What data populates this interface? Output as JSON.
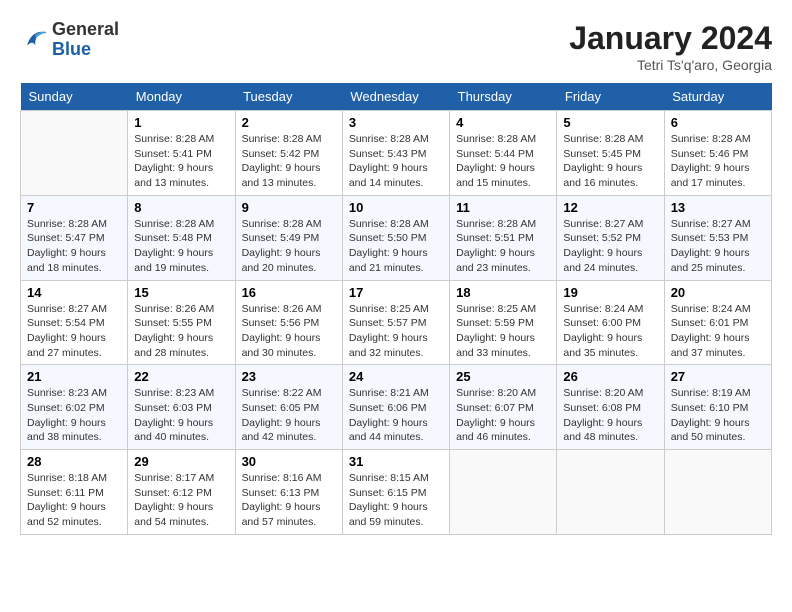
{
  "header": {
    "logo_general": "General",
    "logo_blue": "Blue",
    "month_title": "January 2024",
    "location": "Tetri Ts'q'aro, Georgia"
  },
  "weekdays": [
    "Sunday",
    "Monday",
    "Tuesday",
    "Wednesday",
    "Thursday",
    "Friday",
    "Saturday"
  ],
  "weeks": [
    [
      {
        "day": "",
        "info": ""
      },
      {
        "day": "1",
        "info": "Sunrise: 8:28 AM\nSunset: 5:41 PM\nDaylight: 9 hours\nand 13 minutes."
      },
      {
        "day": "2",
        "info": "Sunrise: 8:28 AM\nSunset: 5:42 PM\nDaylight: 9 hours\nand 13 minutes."
      },
      {
        "day": "3",
        "info": "Sunrise: 8:28 AM\nSunset: 5:43 PM\nDaylight: 9 hours\nand 14 minutes."
      },
      {
        "day": "4",
        "info": "Sunrise: 8:28 AM\nSunset: 5:44 PM\nDaylight: 9 hours\nand 15 minutes."
      },
      {
        "day": "5",
        "info": "Sunrise: 8:28 AM\nSunset: 5:45 PM\nDaylight: 9 hours\nand 16 minutes."
      },
      {
        "day": "6",
        "info": "Sunrise: 8:28 AM\nSunset: 5:46 PM\nDaylight: 9 hours\nand 17 minutes."
      }
    ],
    [
      {
        "day": "7",
        "info": "Sunrise: 8:28 AM\nSunset: 5:47 PM\nDaylight: 9 hours\nand 18 minutes."
      },
      {
        "day": "8",
        "info": "Sunrise: 8:28 AM\nSunset: 5:48 PM\nDaylight: 9 hours\nand 19 minutes."
      },
      {
        "day": "9",
        "info": "Sunrise: 8:28 AM\nSunset: 5:49 PM\nDaylight: 9 hours\nand 20 minutes."
      },
      {
        "day": "10",
        "info": "Sunrise: 8:28 AM\nSunset: 5:50 PM\nDaylight: 9 hours\nand 21 minutes."
      },
      {
        "day": "11",
        "info": "Sunrise: 8:28 AM\nSunset: 5:51 PM\nDaylight: 9 hours\nand 23 minutes."
      },
      {
        "day": "12",
        "info": "Sunrise: 8:27 AM\nSunset: 5:52 PM\nDaylight: 9 hours\nand 24 minutes."
      },
      {
        "day": "13",
        "info": "Sunrise: 8:27 AM\nSunset: 5:53 PM\nDaylight: 9 hours\nand 25 minutes."
      }
    ],
    [
      {
        "day": "14",
        "info": "Sunrise: 8:27 AM\nSunset: 5:54 PM\nDaylight: 9 hours\nand 27 minutes."
      },
      {
        "day": "15",
        "info": "Sunrise: 8:26 AM\nSunset: 5:55 PM\nDaylight: 9 hours\nand 28 minutes."
      },
      {
        "day": "16",
        "info": "Sunrise: 8:26 AM\nSunset: 5:56 PM\nDaylight: 9 hours\nand 30 minutes."
      },
      {
        "day": "17",
        "info": "Sunrise: 8:25 AM\nSunset: 5:57 PM\nDaylight: 9 hours\nand 32 minutes."
      },
      {
        "day": "18",
        "info": "Sunrise: 8:25 AM\nSunset: 5:59 PM\nDaylight: 9 hours\nand 33 minutes."
      },
      {
        "day": "19",
        "info": "Sunrise: 8:24 AM\nSunset: 6:00 PM\nDaylight: 9 hours\nand 35 minutes."
      },
      {
        "day": "20",
        "info": "Sunrise: 8:24 AM\nSunset: 6:01 PM\nDaylight: 9 hours\nand 37 minutes."
      }
    ],
    [
      {
        "day": "21",
        "info": "Sunrise: 8:23 AM\nSunset: 6:02 PM\nDaylight: 9 hours\nand 38 minutes."
      },
      {
        "day": "22",
        "info": "Sunrise: 8:23 AM\nSunset: 6:03 PM\nDaylight: 9 hours\nand 40 minutes."
      },
      {
        "day": "23",
        "info": "Sunrise: 8:22 AM\nSunset: 6:05 PM\nDaylight: 9 hours\nand 42 minutes."
      },
      {
        "day": "24",
        "info": "Sunrise: 8:21 AM\nSunset: 6:06 PM\nDaylight: 9 hours\nand 44 minutes."
      },
      {
        "day": "25",
        "info": "Sunrise: 8:20 AM\nSunset: 6:07 PM\nDaylight: 9 hours\nand 46 minutes."
      },
      {
        "day": "26",
        "info": "Sunrise: 8:20 AM\nSunset: 6:08 PM\nDaylight: 9 hours\nand 48 minutes."
      },
      {
        "day": "27",
        "info": "Sunrise: 8:19 AM\nSunset: 6:10 PM\nDaylight: 9 hours\nand 50 minutes."
      }
    ],
    [
      {
        "day": "28",
        "info": "Sunrise: 8:18 AM\nSunset: 6:11 PM\nDaylight: 9 hours\nand 52 minutes."
      },
      {
        "day": "29",
        "info": "Sunrise: 8:17 AM\nSunset: 6:12 PM\nDaylight: 9 hours\nand 54 minutes."
      },
      {
        "day": "30",
        "info": "Sunrise: 8:16 AM\nSunset: 6:13 PM\nDaylight: 9 hours\nand 57 minutes."
      },
      {
        "day": "31",
        "info": "Sunrise: 8:15 AM\nSunset: 6:15 PM\nDaylight: 9 hours\nand 59 minutes."
      },
      {
        "day": "",
        "info": ""
      },
      {
        "day": "",
        "info": ""
      },
      {
        "day": "",
        "info": ""
      }
    ]
  ]
}
